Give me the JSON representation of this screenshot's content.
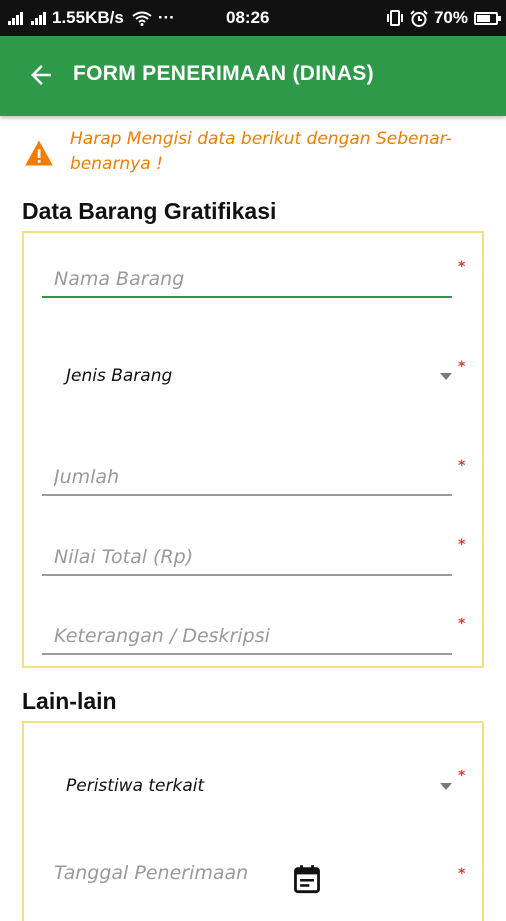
{
  "status_bar": {
    "net_speed": "1.55KB/s",
    "dots": "···",
    "time": "08:26",
    "battery": "70%",
    "battery_level": 0.7,
    "icons": [
      "signal-icon",
      "signal-icon",
      "wifi-icon",
      "vibrate-icon",
      "alarm-icon",
      "battery-icon"
    ]
  },
  "app_bar": {
    "title": "FORM PENERIMAAN (DINAS)",
    "back_icon": "arrow-left-icon",
    "color": "#2e9a49"
  },
  "warning": {
    "icon": "warning-icon",
    "color": "#f57c00",
    "text": "Harap Mengisi data berikut dengan Sebenar-benarnya !"
  },
  "sections": [
    {
      "title": "Data Barang Gratifikasi",
      "fields": [
        {
          "type": "text",
          "placeholder": "Nama Barang",
          "required": true,
          "focused": true
        },
        {
          "type": "select",
          "value": "Jenis Barang",
          "required": true
        },
        {
          "type": "text",
          "placeholder": "Jumlah",
          "required": true
        },
        {
          "type": "text",
          "placeholder": "Nilai Total (Rp)",
          "required": true
        },
        {
          "type": "text",
          "placeholder": "Keterangan / Deskripsi",
          "required": true
        }
      ]
    },
    {
      "title": "Lain-lain",
      "fields": [
        {
          "type": "select",
          "value": "Peristiwa terkait",
          "required": true
        },
        {
          "type": "date",
          "placeholder": "Tanggal Penerimaan",
          "required": true,
          "icon": "calendar-icon"
        }
      ]
    }
  ],
  "required_mark": "*",
  "box_border_color": "#f1e27a"
}
